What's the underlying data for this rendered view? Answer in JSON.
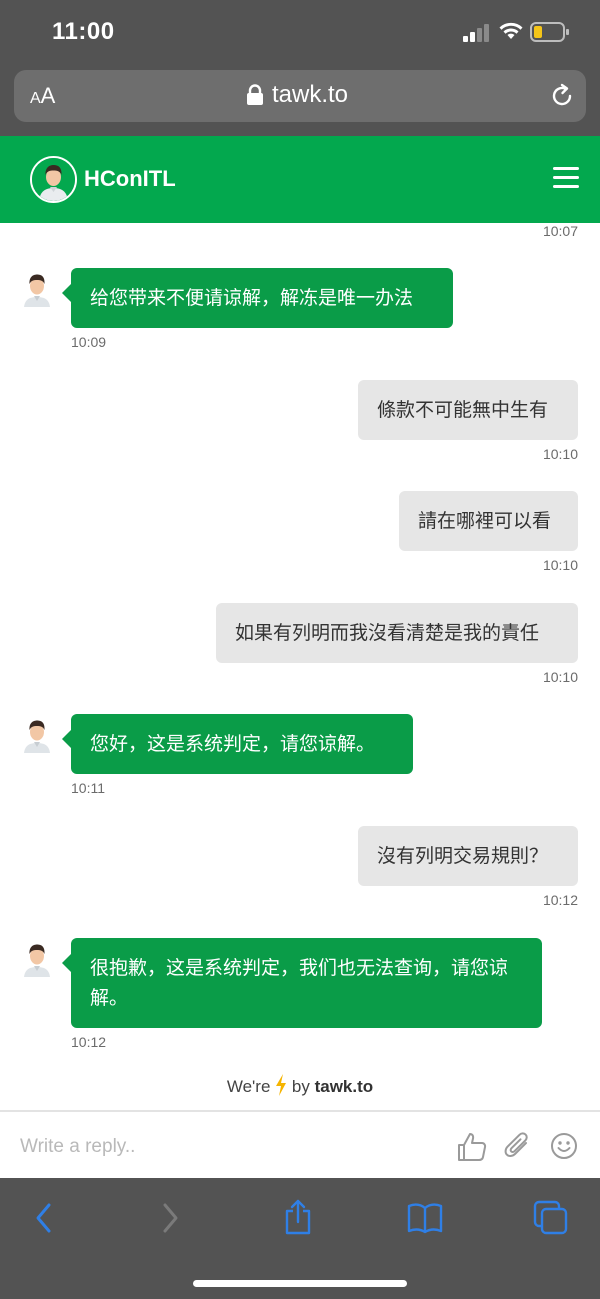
{
  "status_bar": {
    "time": "11:00"
  },
  "browser": {
    "text_size_button": {
      "small": "A",
      "large": "A"
    },
    "domain": "tawk.to"
  },
  "chat_header": {
    "name": "HConITL"
  },
  "messages": [
    {
      "time_label": "10:07"
    },
    {
      "sender": "agent",
      "text": "给您带来不便请谅解，解冻是唯一办法",
      "time": "10:09"
    },
    {
      "sender": "user",
      "text": "條款不可能無中生有",
      "time": "10:10"
    },
    {
      "sender": "user",
      "text": "請在哪裡可以看",
      "time": "10:10"
    },
    {
      "sender": "user",
      "text": "如果有列明而我沒看清楚是我的責任",
      "time": "10:10"
    },
    {
      "sender": "agent",
      "text": "您好，这是系统判定，请您谅解。",
      "time": "10:11"
    },
    {
      "sender": "user",
      "text": "沒有列明交易規則？",
      "time": "10:12"
    },
    {
      "sender": "agent",
      "text": "很抱歉，这是系统判定，我们也无法查询，请您谅解。",
      "time": "10:12"
    }
  ],
  "powered_by": {
    "prefix": "We're",
    "middle": "by",
    "brand": "tawk.to"
  },
  "reply": {
    "placeholder": "Write a reply.."
  },
  "icons": {
    "status": [
      "signal-icon",
      "wifi-icon",
      "battery-icon"
    ],
    "browser": [
      "lock-icon",
      "reload-icon"
    ],
    "reply": [
      "thumbs-up-icon",
      "paperclip-icon",
      "emoji-icon"
    ],
    "toolbar": [
      "back-icon",
      "forward-icon",
      "share-icon",
      "bookmarks-icon",
      "tabs-icon"
    ]
  },
  "colors": {
    "brand_green": "#03a84e",
    "agent_bubble": "#0a9c48",
    "user_bubble": "#e6e6e6",
    "browser_chrome": "#535353",
    "ios_blue": "#2f7fe6",
    "battery_low": "#f5c518"
  }
}
